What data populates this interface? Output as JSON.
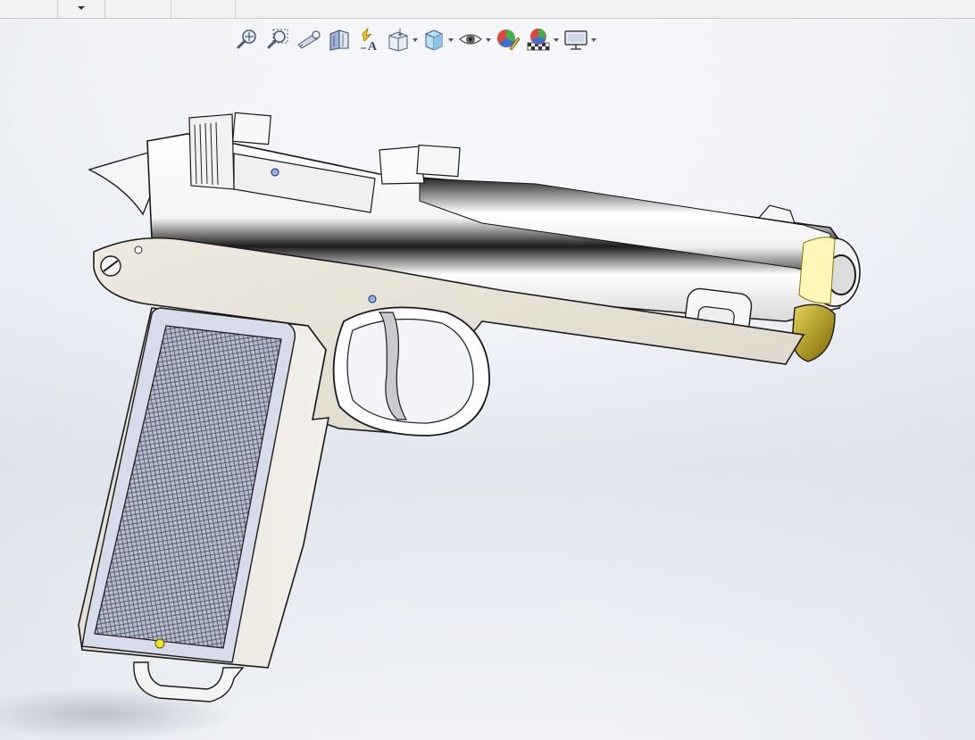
{
  "tabstrip": {
    "segments": [
      {
        "label": ""
      },
      {
        "label": ""
      },
      {
        "label": ""
      }
    ]
  },
  "heads_up_toolbar": {
    "tools": [
      {
        "icon": "zoom-to-fit-icon",
        "has_dropdown": false
      },
      {
        "icon": "zoom-to-area-icon",
        "has_dropdown": false
      },
      {
        "icon": "previous-view-icon",
        "has_dropdown": false
      },
      {
        "icon": "section-view-icon",
        "has_dropdown": false
      },
      {
        "icon": "dynamic-annotation-views-icon",
        "has_dropdown": false
      },
      {
        "icon": "view-orientation-icon",
        "has_dropdown": true
      },
      {
        "icon": "display-style-icon",
        "has_dropdown": true
      },
      {
        "icon": "hide-show-items-icon",
        "has_dropdown": true
      },
      {
        "icon": "edit-appearance-icon",
        "has_dropdown": false
      },
      {
        "icon": "apply-scene-icon",
        "has_dropdown": true
      },
      {
        "icon": "view-settings-icon",
        "has_dropdown": true
      }
    ]
  },
  "graphics_area": {
    "model": "pistol-assembly",
    "background_top": "#ffffff",
    "background_mid": "#e4e8f0"
  },
  "colors": {
    "frame": "#e8e4d8",
    "slide": "#f7f7f7",
    "grip_panel": "#d5d9e6",
    "outline": "#1a1a1a",
    "muzzle_gold": "#c8a800"
  }
}
